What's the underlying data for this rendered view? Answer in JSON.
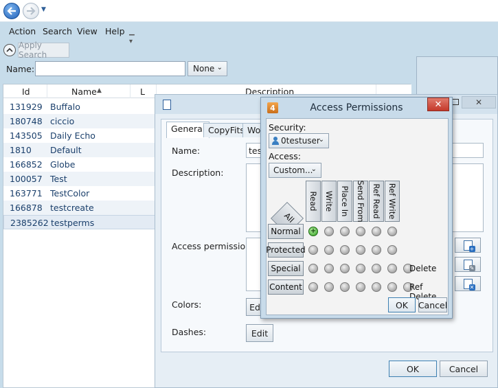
{
  "menu": {
    "items": [
      "Action",
      "Search",
      "View",
      "Help"
    ]
  },
  "search": {
    "apply_label": "Apply Search",
    "name_label": "Name:",
    "name_value": "",
    "filter_selected": "None"
  },
  "grid": {
    "columns": [
      "Id",
      "Name",
      "L",
      "Description"
    ],
    "sort_indicator": "▲",
    "rows": [
      {
        "id": "131929",
        "name": "Buffalo"
      },
      {
        "id": "180748",
        "name": "ciccio"
      },
      {
        "id": "143505",
        "name": "Daily Echo"
      },
      {
        "id": "1810",
        "name": "Default"
      },
      {
        "id": "166852",
        "name": "Globe"
      },
      {
        "id": "100057",
        "name": "Test"
      },
      {
        "id": "163771",
        "name": "TestColor"
      },
      {
        "id": "166878",
        "name": "testcreate"
      },
      {
        "id": "2385262",
        "name": "testperms"
      }
    ]
  },
  "properties": {
    "tabs": [
      "General",
      "CopyFits",
      "Wor"
    ],
    "name_label": "Name:",
    "name_value": "test",
    "description_label": "Description:",
    "access_label": "Access permissions:",
    "colors_label": "Colors:",
    "colors_button": "Ed",
    "dashes_label": "Dashes:",
    "dashes_button": "Edit",
    "ok_label": "OK",
    "cancel_label": "Cancel"
  },
  "access_dialog": {
    "app_icon_text": "4",
    "title": "Access Permissions",
    "close_glyph": "✕",
    "security_label": "Security:",
    "security_value": "0testuser",
    "access_label": "Access:",
    "access_value": "Custom...",
    "all_label": "All",
    "columns": [
      "Read",
      "Write",
      "Place In",
      "Send From",
      "Ref Read",
      "Ref Write"
    ],
    "rows": [
      {
        "label": "Normal",
        "dots": 6,
        "active_index": 0,
        "extra": ""
      },
      {
        "label": "Protected",
        "dots": 6,
        "active_index": -1,
        "extra": ""
      },
      {
        "label": "Special",
        "dots": 7,
        "active_index": -1,
        "extra": "Delete"
      },
      {
        "label": "Content",
        "dots": 7,
        "active_index": -1,
        "extra": "Ref Delete"
      }
    ],
    "ok_label": "OK",
    "cancel_label": "Cancel"
  }
}
